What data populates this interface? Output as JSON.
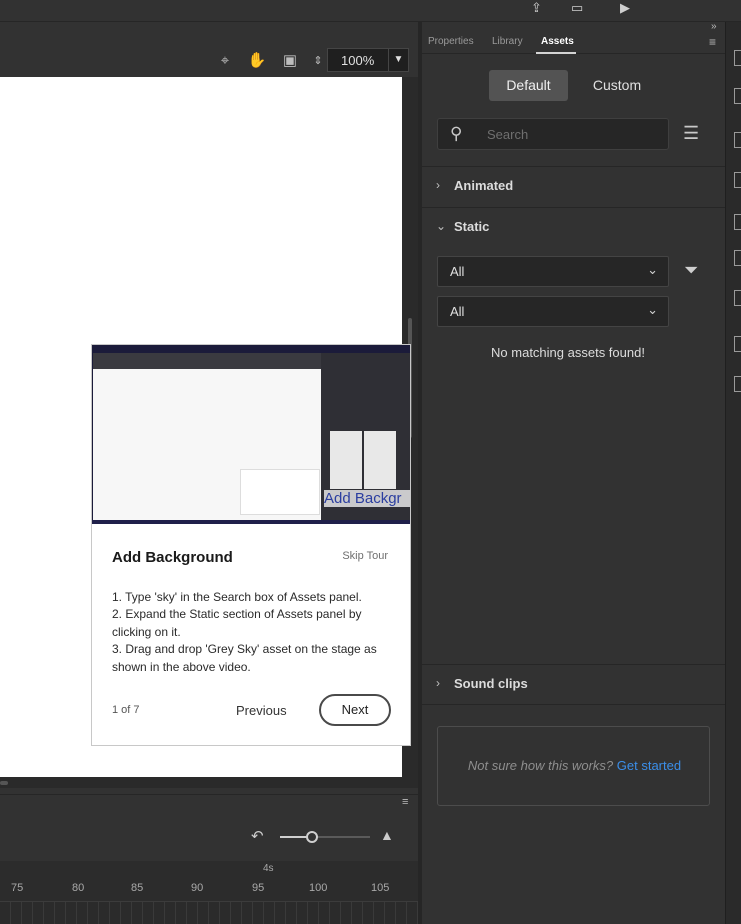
{
  "topbar": {
    "icons": [
      "share-icon",
      "layout-icon",
      "play-icon"
    ]
  },
  "stage_toolbar": {
    "icons": [
      "center-stage-icon",
      "hand-icon",
      "clip-icon",
      "rotate-icon"
    ],
    "zoom": "100%"
  },
  "timeline": {
    "ruler_labels": [
      "75",
      "80",
      "85",
      "90",
      "95",
      "100",
      "105"
    ],
    "seconds_label": "4s"
  },
  "panel": {
    "tabs": [
      {
        "label": "Properties",
        "active": false
      },
      {
        "label": "Library",
        "active": false
      },
      {
        "label": "Assets",
        "active": true
      }
    ],
    "segments": {
      "default": "Default",
      "custom": "Custom"
    },
    "search_placeholder": "Search",
    "sections": {
      "animated": "Animated",
      "static": "Static",
      "sound": "Sound clips"
    },
    "filter1": "All",
    "filter2": "All",
    "empty_message": "No matching assets found!",
    "help_text": "Not sure how this works?",
    "help_link": "Get started"
  },
  "tour": {
    "video_caption": "Add Backgr",
    "title": "Add Background",
    "skip": "Skip Tour",
    "steps": [
      "1. Type 'sky' in the Search box of Assets panel.",
      "2. Expand the Static section of Assets panel by clicking on it.",
      "3. Drag and drop 'Grey Sky' asset on the stage as shown in the above video."
    ],
    "position": "1 of 7",
    "previous": "Previous",
    "next": "Next"
  }
}
